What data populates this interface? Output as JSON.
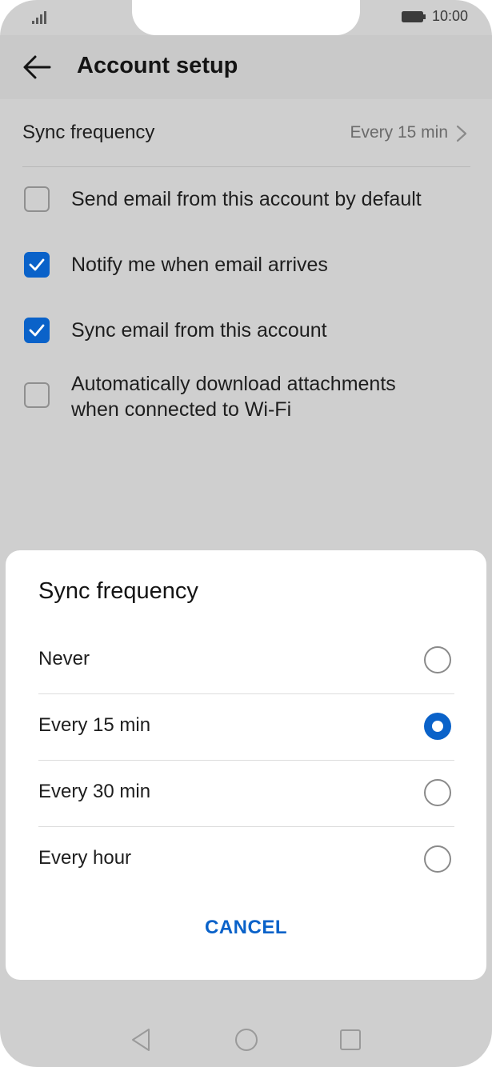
{
  "status_bar": {
    "time": "10:00"
  },
  "header": {
    "title": "Account setup"
  },
  "settings": {
    "sync_frequency": {
      "label": "Sync frequency",
      "value": "Every 15 min"
    },
    "checkboxes": [
      {
        "label": "Send email from this account by default",
        "checked": false
      },
      {
        "label": "Notify me when email arrives",
        "checked": true
      },
      {
        "label": "Sync email from this account",
        "checked": true
      },
      {
        "label": "Automatically download attachments",
        "label2": "when connected to Wi-Fi",
        "checked": false
      }
    ]
  },
  "dialog": {
    "title": "Sync frequency",
    "options": [
      {
        "label": "Never",
        "selected": false
      },
      {
        "label": "Every 15 min",
        "selected": true
      },
      {
        "label": "Every 30 min",
        "selected": false
      },
      {
        "label": "Every hour",
        "selected": false
      }
    ],
    "cancel_label": "CANCEL"
  },
  "colors": {
    "accent": "#0a62c9",
    "scrim": "#cfcfcf",
    "dialog_bg": "#ffffff"
  },
  "icons": {
    "back": "arrow-left-icon",
    "chevron": "chevron-right-icon",
    "nav_back": "triangle-back-icon",
    "nav_home": "circle-home-icon",
    "nav_recent": "square-recent-icon"
  }
}
